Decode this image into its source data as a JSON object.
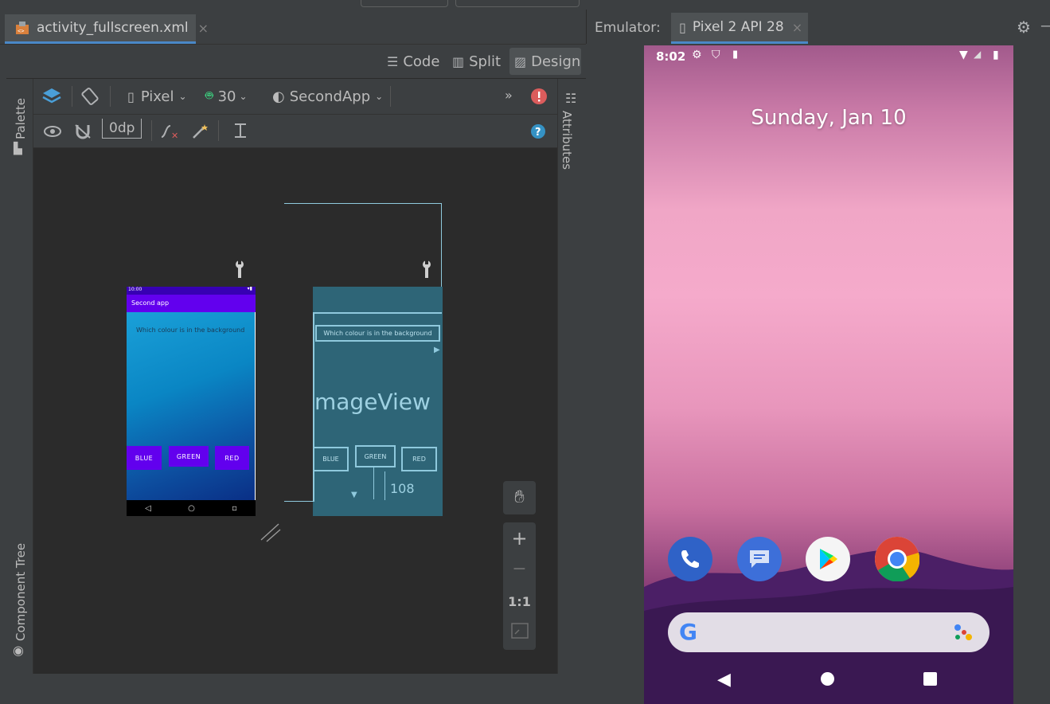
{
  "editor": {
    "tab": {
      "label": "activity_fullscreen.xml",
      "close": "×"
    },
    "modes": [
      {
        "label": "Code"
      },
      {
        "label": "Split"
      },
      {
        "label": "Design"
      }
    ],
    "active_mode": "Design",
    "side_left": {
      "palette": "Palette",
      "component_tree": "Component Tree"
    },
    "side_right": {
      "attributes": "Attributes"
    },
    "toolbar1": {
      "device": "Pixel",
      "api": "30",
      "theme": "SecondApp",
      "overflow": "»"
    },
    "toolbar2": {
      "margin": "0dp"
    },
    "accent_error": "#db5c5c",
    "accent_help": "#3592c4"
  },
  "design_preview": {
    "status_time": "10:00",
    "app_title": "Second app",
    "prompt": "Which colour is in the background",
    "buttons": [
      "BLUE",
      "GREEN",
      "RED"
    ],
    "app_bar_color": "#6200ee"
  },
  "blueprint": {
    "prompt": "Which colour is in the background",
    "image_view": "mageView",
    "buttons": [
      "BLUE",
      "GREEN",
      "RED"
    ],
    "dimension": "108"
  },
  "zoom": {
    "plus": "+",
    "minus": "−",
    "reset": "1:1"
  },
  "emulator": {
    "label": "Emulator:",
    "device_tab": "Pixel 2 API 28",
    "close": "×"
  },
  "phone": {
    "time": "8:02",
    "date": "Sunday, Jan 10",
    "dock_apps": [
      {
        "name": "phone-app-icon"
      },
      {
        "name": "messages-app-icon"
      },
      {
        "name": "play-store-app-icon"
      },
      {
        "name": "chrome-app-icon"
      }
    ],
    "search_logo": "G"
  }
}
